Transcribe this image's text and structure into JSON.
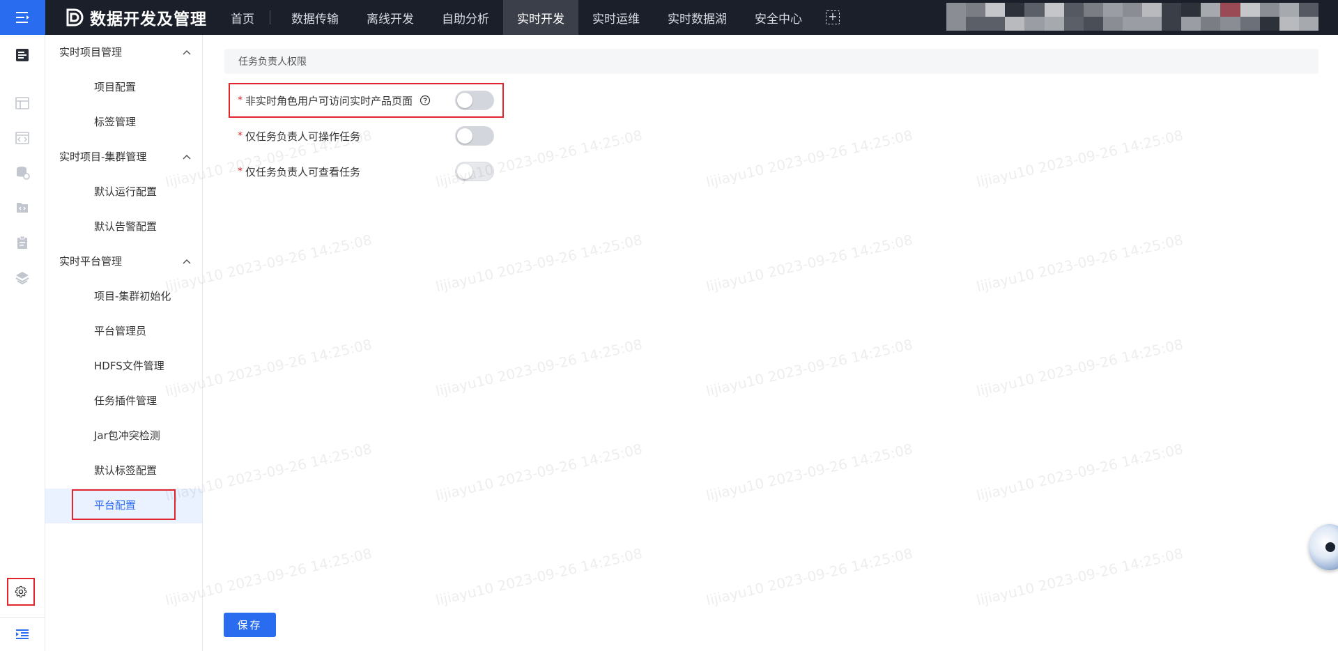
{
  "header": {
    "brand_title": "数据开发及管理",
    "nav": [
      {
        "label": "首页"
      },
      {
        "label": "数据传输"
      },
      {
        "label": "离线开发"
      },
      {
        "label": "自助分析"
      },
      {
        "label": "实时开发",
        "active": true
      },
      {
        "label": "实时运维"
      },
      {
        "label": "实时数据湖"
      },
      {
        "label": "安全中心"
      }
    ],
    "add_glyph": "+"
  },
  "rail": {
    "icons": [
      "document-icon",
      "table-icon",
      "code-icon",
      "database-icon",
      "file-code-icon",
      "clipboard-icon",
      "stack-icon",
      "gear-icon",
      "indent-icon"
    ]
  },
  "sidebar": {
    "groups": [
      {
        "title": "实时项目管理",
        "items": [
          "项目配置",
          "标签管理"
        ]
      },
      {
        "title": "实时项目-集群管理",
        "items": [
          "默认运行配置",
          "默认告警配置"
        ]
      },
      {
        "title": "实时平台管理",
        "items": [
          "项目-集群初始化",
          "平台管理员",
          "HDFS文件管理",
          "任务插件管理",
          "Jar包冲突检测",
          "默认标签配置",
          "平台配置"
        ]
      }
    ],
    "active_item": "平台配置"
  },
  "main": {
    "section_title": "任务负责人权限",
    "fields": [
      {
        "label": "非实时角色用户可访问实时产品页面",
        "required": "*",
        "has_help": true,
        "enabled": false
      },
      {
        "label": "仅任务负责人可操作任务",
        "required": "*",
        "has_help": false,
        "enabled": false
      },
      {
        "label": "仅任务负责人可查看任务",
        "required": "*",
        "has_help": false,
        "enabled": false
      }
    ],
    "save_label": "保存"
  },
  "watermark": "lijiayu10 2023-09-26 14:25:08",
  "colors": {
    "topbar_bg": "#1b1f2a",
    "accent": "#2a6cf0",
    "highlight": "#e0262c",
    "active_nav_bg": "#3b3f49"
  }
}
